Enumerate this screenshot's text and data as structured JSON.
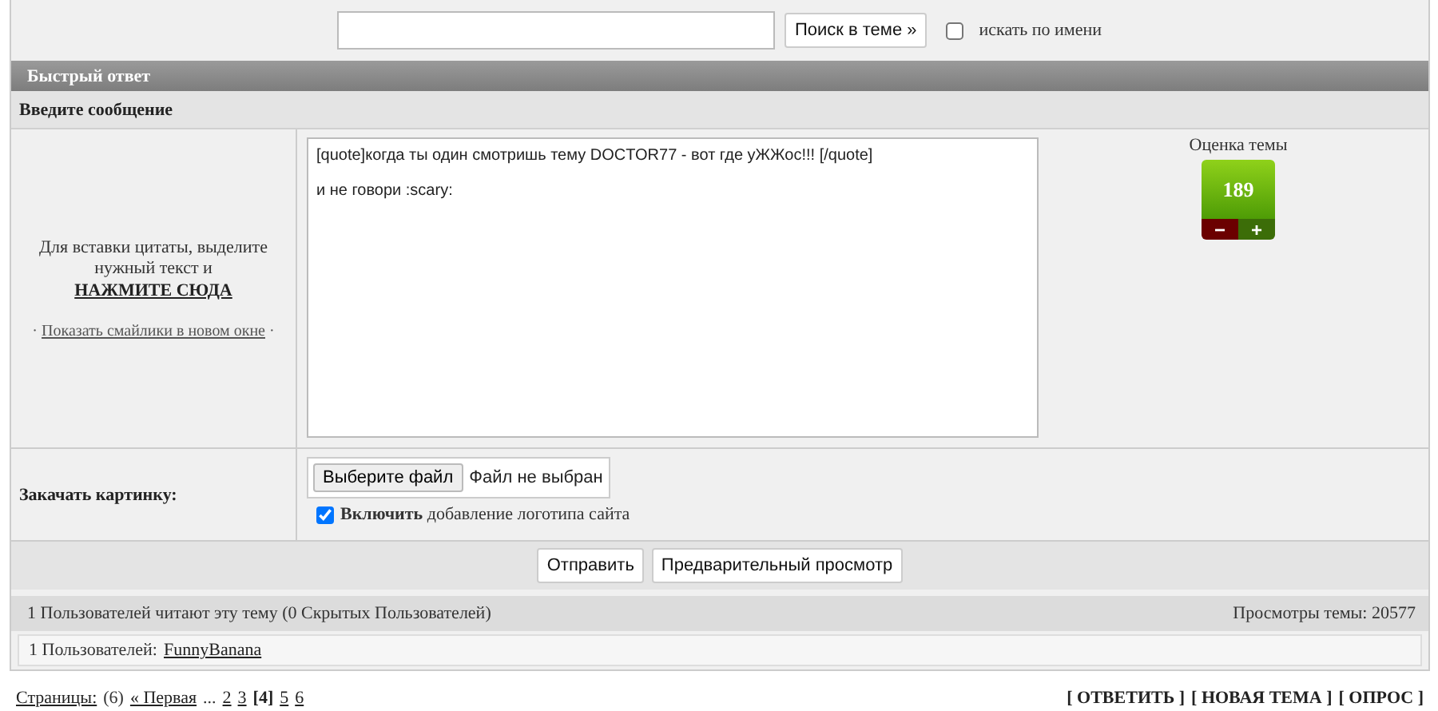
{
  "search": {
    "button": "Поиск в теме »",
    "by_name": {
      "label": "искать по имени",
      "checked": false
    }
  },
  "quick_reply": {
    "title": "Быстрый ответ",
    "subtitle": "Введите сообщение",
    "quote_hint": "Для вставки цитаты, выделите нужный текст и",
    "quote_link": "НАЖМИТЕ СЮДА",
    "bullet": "·",
    "smilies_link": "Показать смайлики в новом окне",
    "bullet_end": "·",
    "message_lines": [
      "[quote]когда ты один смотришь тему DOCTOR77 - вот где уЖЖос!!! [/quote]",
      "и не говори  :scary:"
    ],
    "rating": {
      "label": "Оценка темы",
      "value": "189",
      "minus": "−",
      "plus": "+"
    },
    "upload": {
      "label": "Закачать картинку:",
      "choose": "Выберите файл",
      "status": "Файл не выбран",
      "logo": {
        "text": "**Включить** добавление логотипа сайта",
        "checked": true
      }
    },
    "buttons": [
      "Отправить",
      "Предварительный просмотр"
    ]
  },
  "readers": {
    "summary": "1 Пользователей читают эту тему (0 Скрытых Пользователей)",
    "views": "Просмотры темы: 20577",
    "users_label": "1 Пользователей:",
    "users": [
      "FunnyBanana"
    ]
  },
  "pager": [
    {
      "kind": "link",
      "text": "Страницы:"
    },
    {
      "kind": "text",
      "text": "(6)"
    },
    {
      "kind": "link",
      "text": "« Первая"
    },
    {
      "kind": "text",
      "text": "..."
    },
    {
      "kind": "link",
      "text": "2"
    },
    {
      "kind": "link",
      "text": "3"
    },
    {
      "kind": "current",
      "text": "[4]"
    },
    {
      "kind": "link",
      "text": "5"
    },
    {
      "kind": "link",
      "text": "6"
    }
  ],
  "actions": [
    "[ ОТВЕТИТЬ ]",
    "[ НОВАЯ ТЕМА ]",
    "[ ОПРОС ]"
  ]
}
